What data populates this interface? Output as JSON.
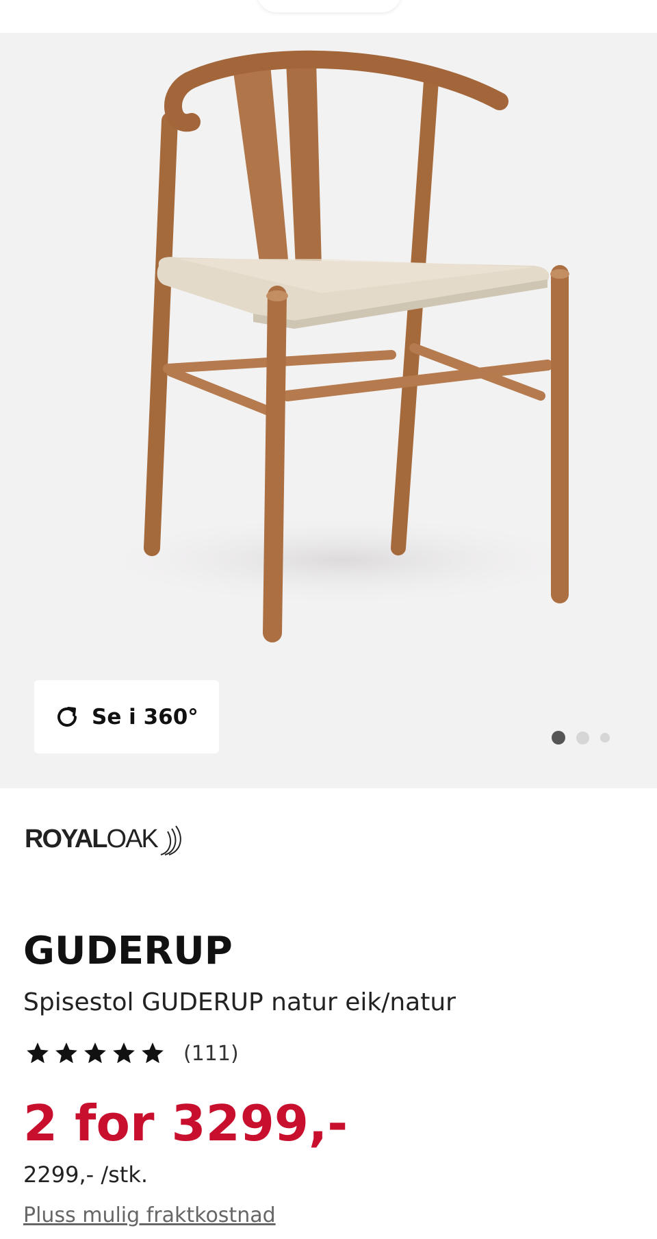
{
  "gallery": {
    "view_360_label": "Se i 360°",
    "slide_count": 3,
    "active_slide": 1
  },
  "brand": {
    "logo_part1": "ROYAL",
    "logo_part2": "OAK"
  },
  "product": {
    "name": "GUDERUP",
    "subtitle": "Spisestol GUDERUP natur eik/natur",
    "rating_stars": 5,
    "review_count": "(111)",
    "offer_price": "2 for 3299,-",
    "unit_price": "2299,- /stk.",
    "shipping_link": "Pluss mulig fraktkostnad"
  },
  "colors": {
    "price_red": "#c8102e",
    "gallery_bg": "#f3f2f3"
  }
}
